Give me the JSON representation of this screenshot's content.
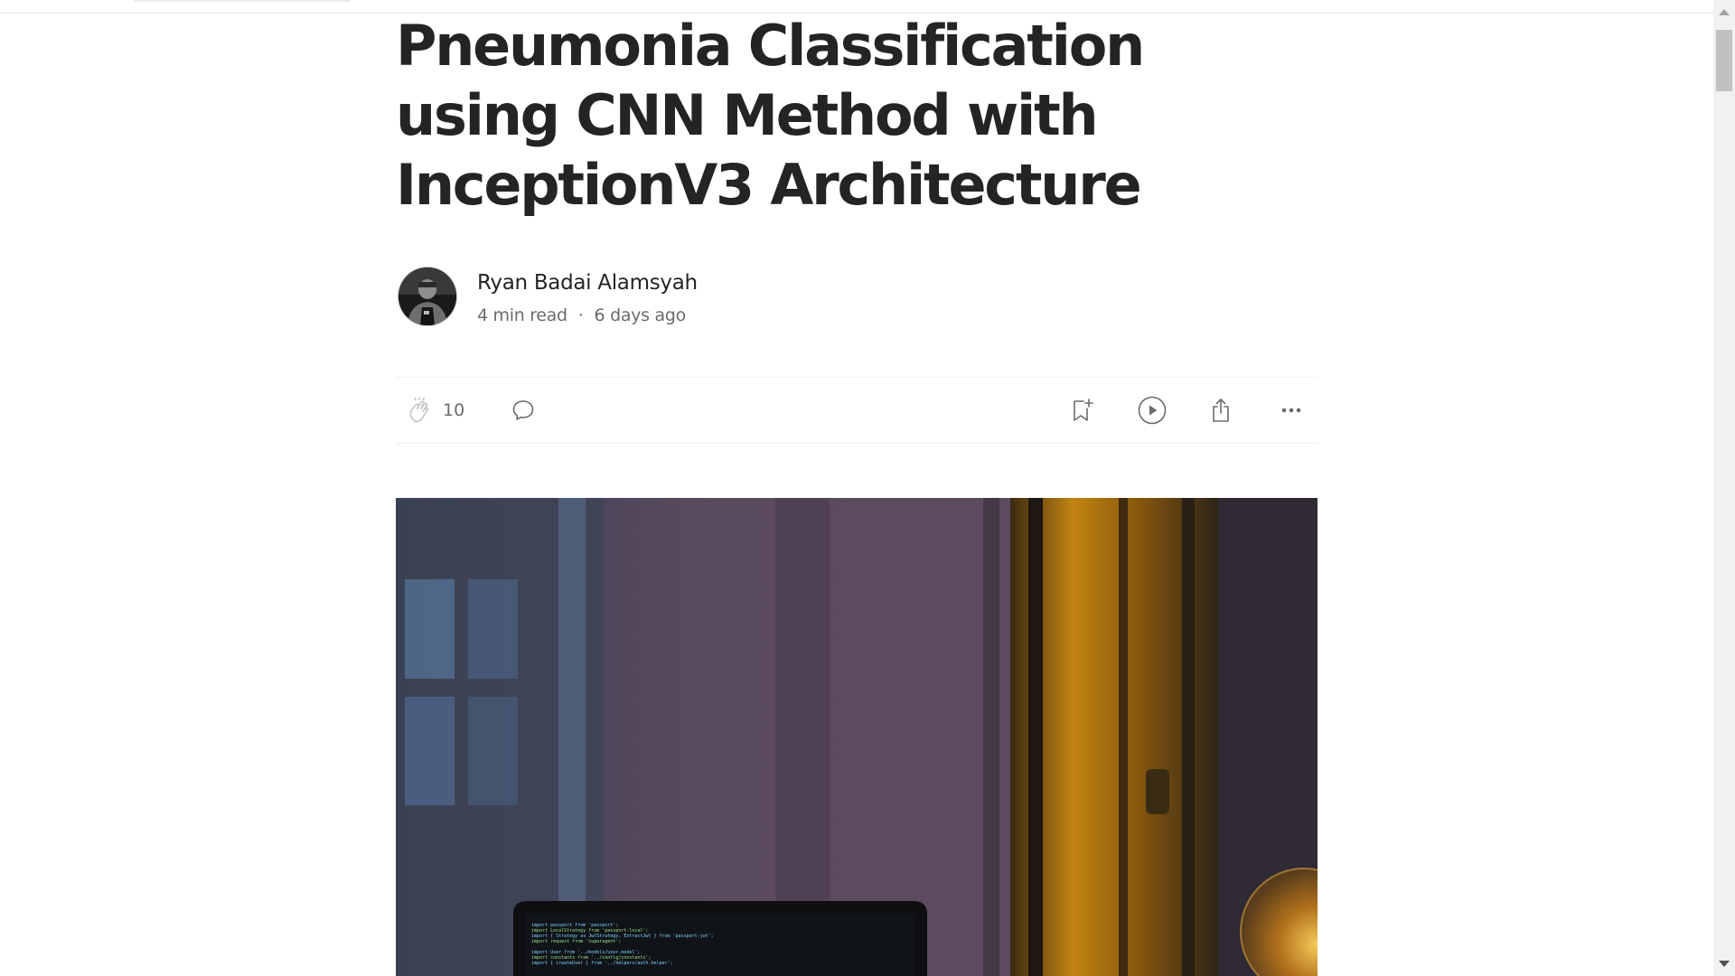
{
  "article": {
    "title": "Pneumonia Classification using CNN Method with InceptionV3 Architecture",
    "author": {
      "name": "Ryan Badai Alamsyah",
      "read_time": "4 min read",
      "separator": "·",
      "published": "6 days ago"
    }
  },
  "actions": {
    "clap_count": "10",
    "icons": [
      "clap-icon",
      "comment-icon",
      "bookmark-add-icon",
      "play-icon",
      "share-icon",
      "more-icon"
    ]
  },
  "hero_image": {
    "code_lines": [
      "import passport from 'passport';",
      "import LocalStrategy from 'passport-local';",
      "import { Strategy as JwtStrategy, ExtractJwt } from 'passport-jwt';",
      "import request from 'superagent';",
      "",
      "import User from '../models/user.model';",
      "import constants from '../config/constants';",
      "import { createUser } from '../helpers/auth.helper';"
    ]
  },
  "colors": {
    "text_primary": "#242424",
    "text_secondary": "#6b6b6b",
    "divider": "#f0f0f0"
  }
}
